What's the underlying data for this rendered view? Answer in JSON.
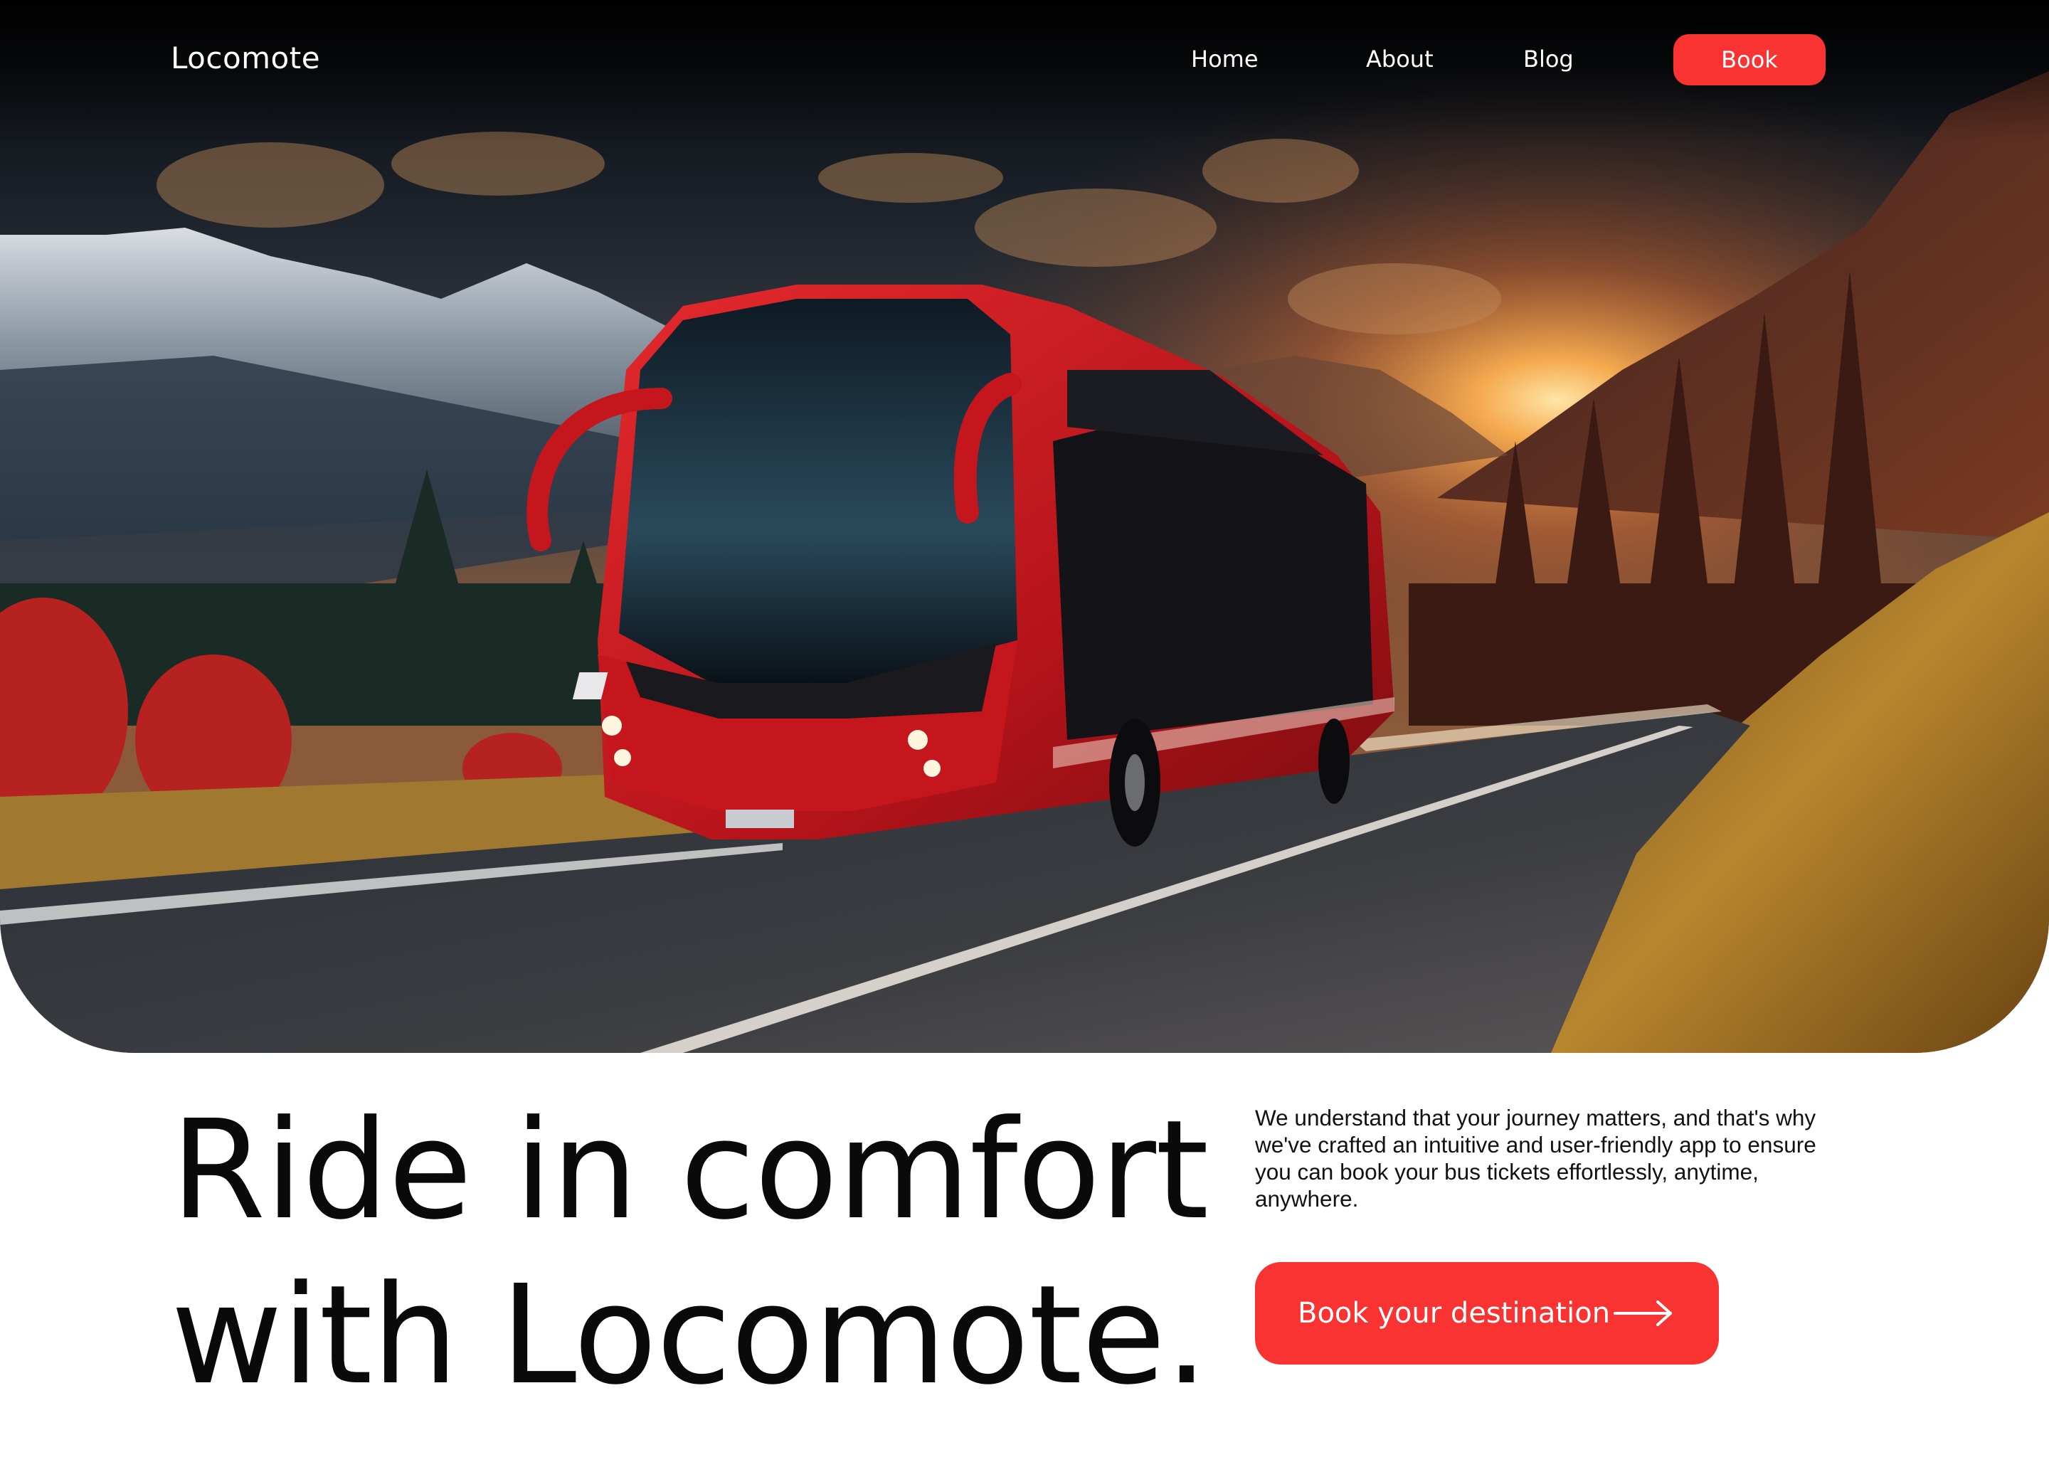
{
  "brand": {
    "name": "Locomote"
  },
  "nav": {
    "links": [
      {
        "label": "Home"
      },
      {
        "label": "About"
      },
      {
        "label": "Blog"
      }
    ],
    "book_label": "Book"
  },
  "hero": {
    "image": "red-coach-bus-on-mountain-road-at-sunset",
    "colors": {
      "accent": "#f93232",
      "bus": "#c4161c"
    }
  },
  "content": {
    "headline_line1": "Ride in comfort",
    "headline_line2": "with Locomote.",
    "description": "We understand that your journey matters, and that's why we've crafted an intuitive and user-friendly app to ensure you can book your bus tickets effortlessly, anytime, anywhere.",
    "cta_label": "Book your destination",
    "cta_icon": "arrow-right-icon"
  }
}
